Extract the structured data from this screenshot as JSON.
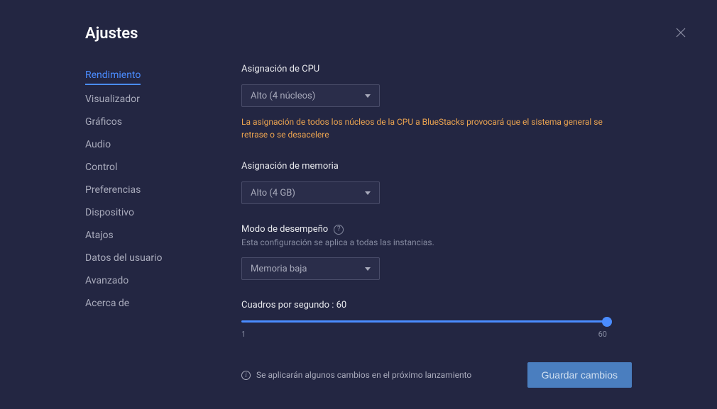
{
  "header": {
    "title": "Ajustes"
  },
  "sidebar": {
    "items": [
      {
        "label": "Rendimiento",
        "active": true
      },
      {
        "label": "Visualizador"
      },
      {
        "label": "Gráficos"
      },
      {
        "label": "Audio"
      },
      {
        "label": "Control"
      },
      {
        "label": "Preferencias"
      },
      {
        "label": "Dispositivo"
      },
      {
        "label": "Atajos"
      },
      {
        "label": "Datos del usuario"
      },
      {
        "label": "Avanzado"
      },
      {
        "label": "Acerca de"
      }
    ]
  },
  "main": {
    "cpu": {
      "label": "Asignación de CPU",
      "value": "Alto (4 núcleos)",
      "warning": "La asignación de todos los núcleos de la CPU a BlueStacks provocará que el sistema general se retrase o se desacelere"
    },
    "memory": {
      "label": "Asignación de memoria",
      "value": "Alto (4 GB)"
    },
    "performance_mode": {
      "label": "Modo de desempeño",
      "desc": "Esta configuración se aplica a todas las instancias.",
      "value": "Memoria baja"
    },
    "fps": {
      "label_prefix": "Cuadros por segundo :",
      "value": "60",
      "min": "1",
      "max": "60"
    }
  },
  "footer": {
    "notice": "Se aplicarán algunos cambios en el próximo lanzamiento",
    "save_label": "Guardar cambios"
  }
}
